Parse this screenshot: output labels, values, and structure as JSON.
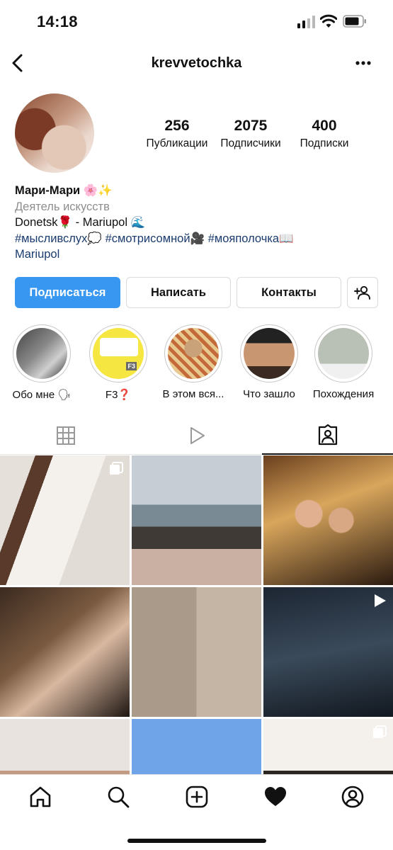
{
  "status": {
    "time": "14:18"
  },
  "header": {
    "username": "krevvetochka"
  },
  "stats": [
    {
      "value": "256",
      "label": "Публикации"
    },
    {
      "value": "2075",
      "label": "Подписчики"
    },
    {
      "value": "400",
      "label": "Подписки"
    }
  ],
  "bio": {
    "name": "Мари-Мари 🌸✨",
    "category": "Деятель искусств",
    "line1": "Donetsk🌹 - Mariupol 🌊",
    "tags": [
      "#мысливслух💭",
      "#смотрисомной🎥",
      "#мояполочка📖"
    ],
    "line3": "Mariupol"
  },
  "buttons": {
    "follow": "Подписаться",
    "message": "Написать",
    "contacts": "Контакты"
  },
  "highlights": [
    {
      "label": "Обо мне 🗣"
    },
    {
      "label": "F3❓"
    },
    {
      "label": "В этом вся..."
    },
    {
      "label": "Что зашло"
    },
    {
      "label": "Похождения"
    }
  ],
  "colors": {
    "accent": "#3897f0",
    "hashtag": "#1a3b6e",
    "muted": "#8e8e8e"
  },
  "tabs": [
    "grid-icon",
    "reels-icon",
    "tagged-icon"
  ],
  "nav": [
    "home-icon",
    "search-icon",
    "new-post-icon",
    "activity-icon",
    "profile-icon"
  ]
}
